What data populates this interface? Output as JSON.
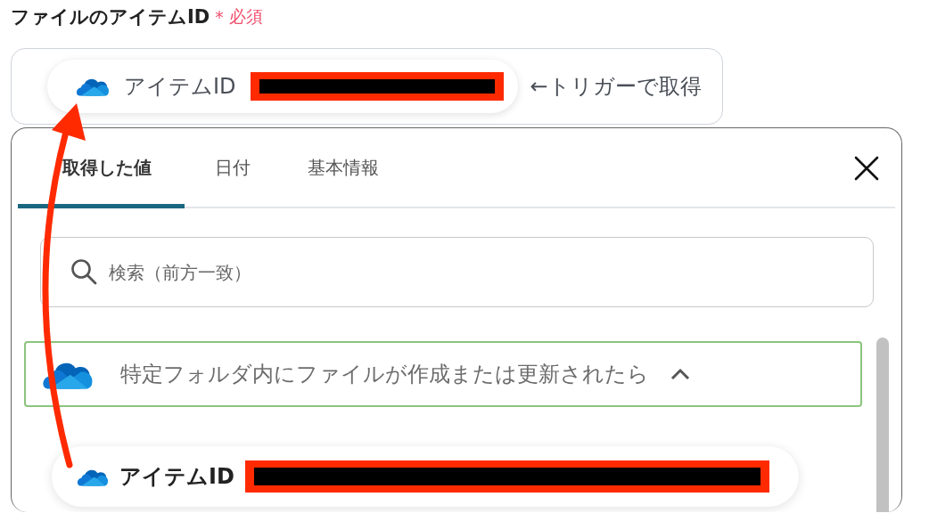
{
  "field": {
    "label": "ファイルのアイテムID",
    "required_mark": "*",
    "required_text": "必須",
    "token": {
      "label": "アイテムID",
      "redacted": true
    },
    "suffix": "←トリガーで取得"
  },
  "picker": {
    "tabs": [
      {
        "label": "取得した値",
        "selected": true
      },
      {
        "label": "日付",
        "selected": false
      },
      {
        "label": "基本情報",
        "selected": false
      }
    ],
    "search": {
      "placeholder": "検索（前方一致）"
    },
    "groups": [
      {
        "title": "特定フォルダ内にファイルが作成または更新されたら",
        "expanded": true,
        "items": [
          {
            "label": "アイテムID",
            "redacted": true
          }
        ]
      }
    ]
  }
}
